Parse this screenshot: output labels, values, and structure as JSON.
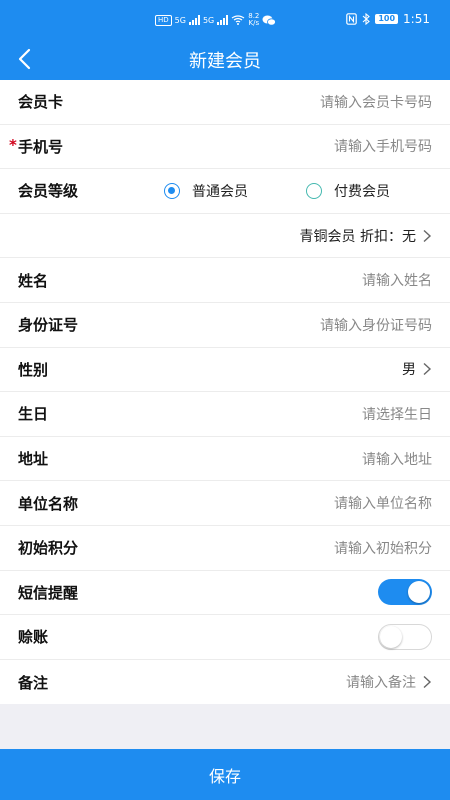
{
  "status_bar": {
    "hd": "HD",
    "net1": "5G",
    "net2": "5G",
    "speed_value": "8.2",
    "speed_unit": "K/s",
    "battery": "100",
    "time": "1:51"
  },
  "nav": {
    "title": "新建会员"
  },
  "form": {
    "member_card": {
      "label": "会员卡",
      "placeholder": "请输入会员卡号码"
    },
    "phone": {
      "required_mark": "*",
      "label": "手机号",
      "placeholder": "请输入手机号码"
    },
    "level": {
      "label": "会员等级",
      "options": [
        {
          "label": "普通会员",
          "selected": true
        },
        {
          "label": "付费会员",
          "selected": false
        }
      ],
      "summary": "青铜会员 折扣：无"
    },
    "name": {
      "label": "姓名",
      "placeholder": "请输入姓名"
    },
    "id_number": {
      "label": "身份证号",
      "placeholder": "请输入身份证号码"
    },
    "gender": {
      "label": "性别",
      "value": "男"
    },
    "birthday": {
      "label": "生日",
      "placeholder": "请选择生日"
    },
    "address": {
      "label": "地址",
      "placeholder": "请输入地址"
    },
    "company": {
      "label": "单位名称",
      "placeholder": "请输入单位名称"
    },
    "initial_points": {
      "label": "初始积分",
      "placeholder": "请输入初始积分"
    },
    "sms_reminder": {
      "label": "短信提醒",
      "enabled": true
    },
    "credit": {
      "label": "赊账",
      "enabled": false
    },
    "remark": {
      "label": "备注",
      "placeholder": "请输入备注"
    }
  },
  "save_label": "保存",
  "colors": {
    "primary": "#1e8cf0",
    "required": "#d0021b",
    "page_bg": "#efeff4"
  }
}
